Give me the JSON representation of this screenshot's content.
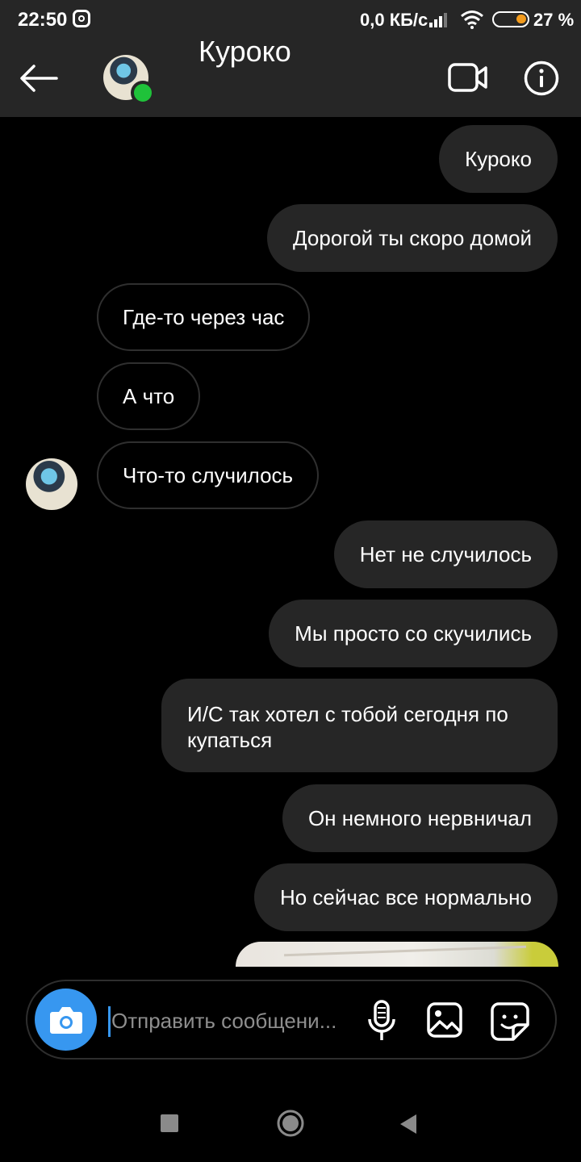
{
  "status_bar": {
    "time": "22:50",
    "network_speed": "0,0 КБ/с",
    "battery": "27 %",
    "icons": [
      "instagram-icon",
      "signal-icon",
      "wifi-icon",
      "battery-icon"
    ],
    "battery_level_percent": 27
  },
  "header": {
    "title": "Куроко",
    "online": true
  },
  "messages": [
    {
      "text": "Куроко",
      "direction": "out"
    },
    {
      "text": "Дорогой ты скоро домой",
      "direction": "out"
    },
    {
      "text": "Где-то через час",
      "direction": "in"
    },
    {
      "text": "А что",
      "direction": "in"
    },
    {
      "text": "Что-то случилось",
      "direction": "in"
    },
    {
      "text": "Нет не случилось",
      "direction": "out"
    },
    {
      "text": "Мы просто со скучились",
      "direction": "out"
    },
    {
      "text": "И/С так хотел с тобой сегодня по купаться",
      "direction": "out"
    },
    {
      "text": "Он немного нервничал",
      "direction": "out"
    },
    {
      "text": "Но сейчас все нормально",
      "direction": "out"
    }
  ],
  "composer": {
    "placeholder": "Отправить сообщени..."
  },
  "colors": {
    "accent": "#3797f0",
    "online": "#1fc23a",
    "bar_background": "#262626",
    "bubble_out": "#262626",
    "background": "#000000"
  }
}
